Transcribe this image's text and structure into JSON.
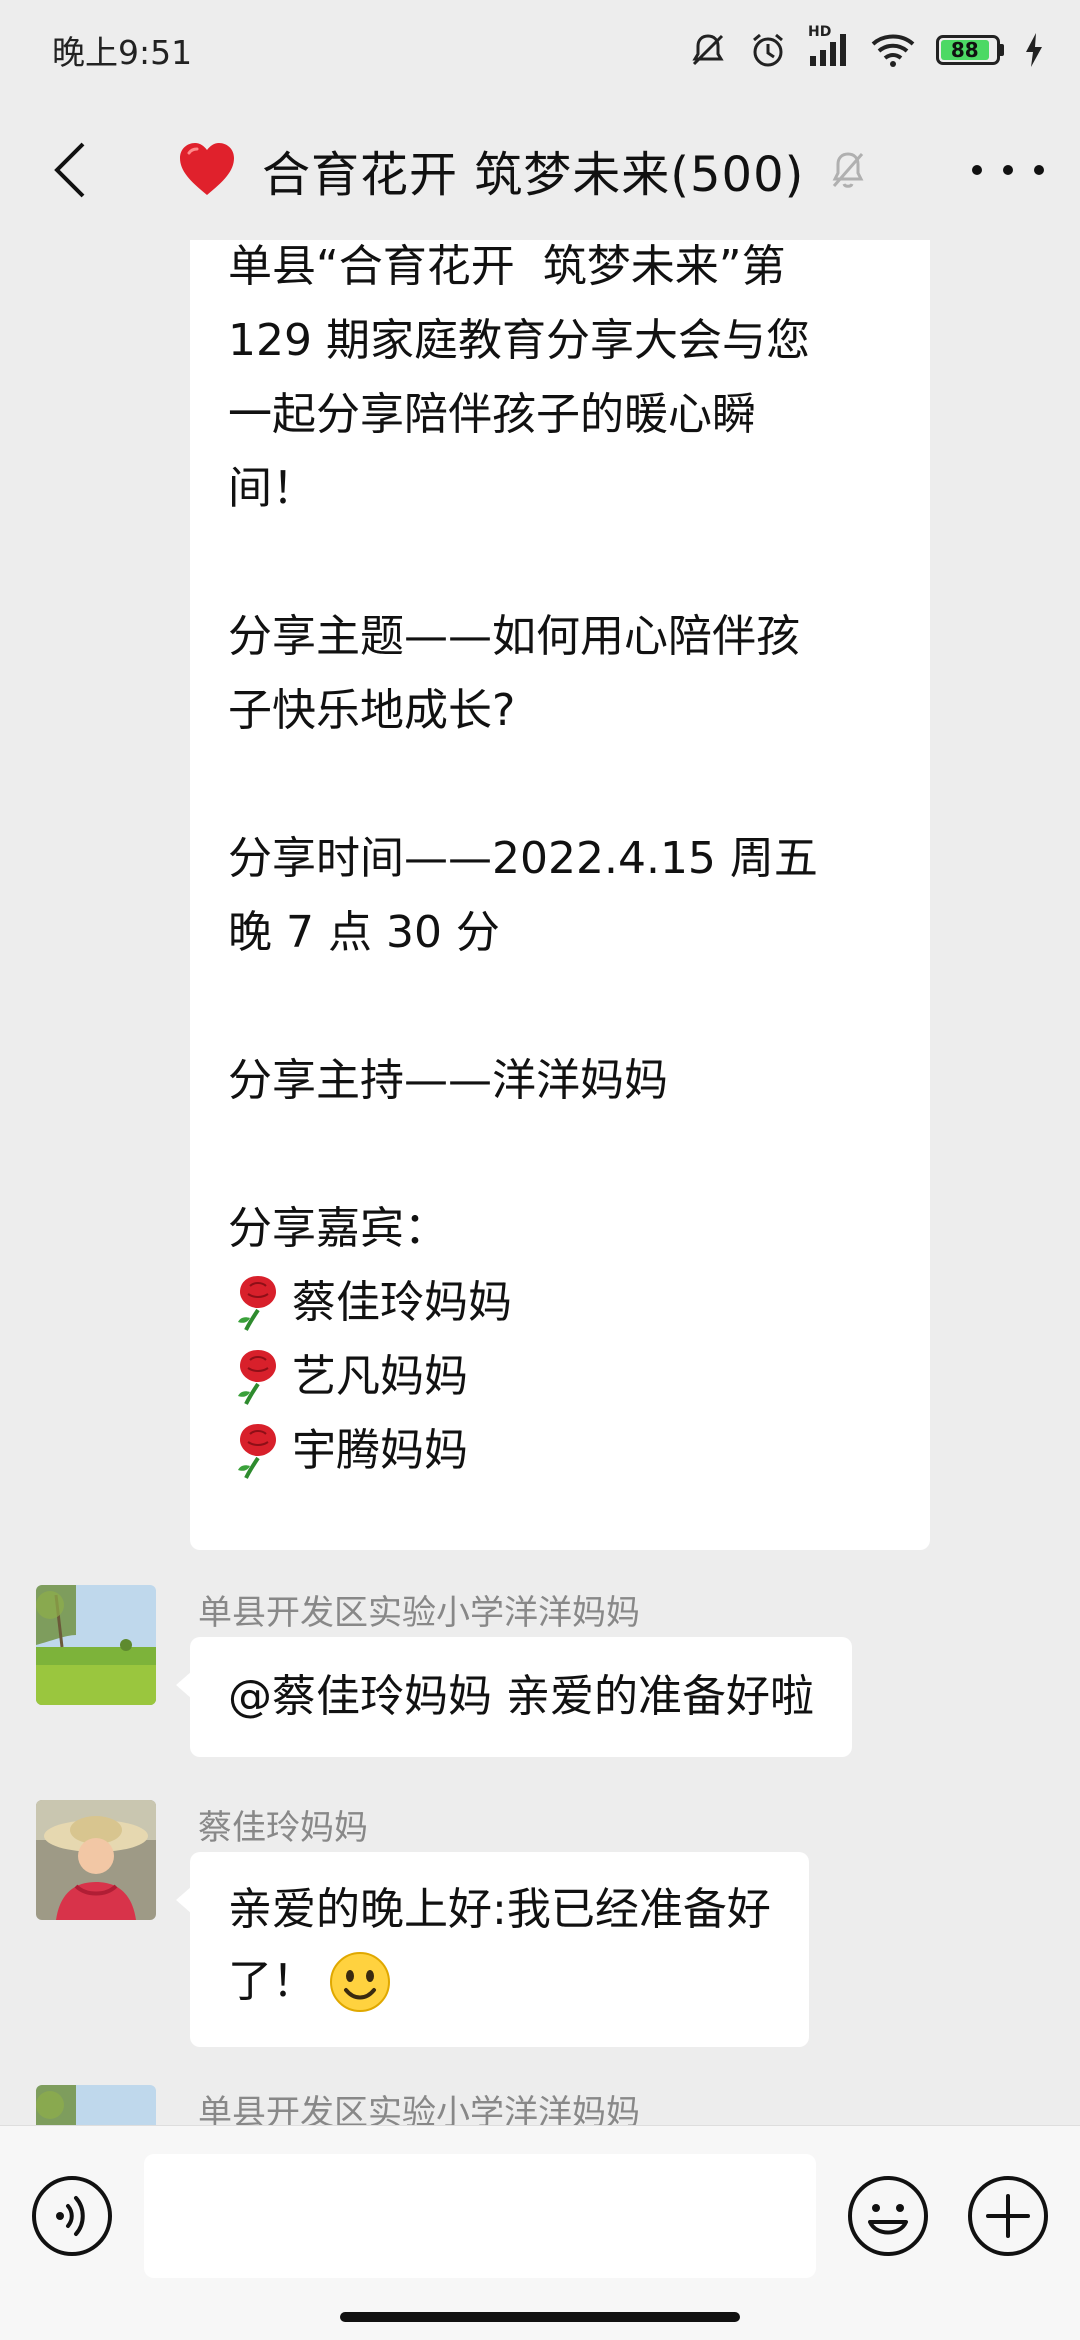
{
  "status_bar": {
    "time": "晚上9:51",
    "battery_level": "88",
    "network_label": "HD"
  },
  "header": {
    "title": "合育花开 筑梦未来(500)"
  },
  "messages": {
    "announcement": {
      "line1": "单县“合育花开  筑梦未来”第",
      "line2": "129 期家庭教育分享大会与您",
      "line3": "一起分享陪伴孩子的暖心瞬",
      "line4": "间！",
      "topic_line1": "分享主题——如何用心陪伴孩",
      "topic_line2": "子快乐地成长?",
      "time_line1": "分享时间——2022.4.15 周五",
      "time_line2": "晚 7 点 30 分",
      "host_line": "分享主持——洋洋妈妈",
      "guests_label": "分享嘉宾：",
      "guests": [
        "蔡佳玲妈妈",
        "艺凡妈妈",
        "宇腾妈妈"
      ]
    },
    "msg1": {
      "sender": "单县开发区实验小学洋洋妈妈",
      "text": "@蔡佳玲妈妈  亲爱的准备好啦"
    },
    "msg2": {
      "sender": "蔡佳玲妈妈",
      "text_line1": "亲爱的晚上好:我已经准备好",
      "text_line2": "了！"
    },
    "msg3": {
      "sender": "单县开发区实验小学洋洋妈妈"
    }
  },
  "colors": {
    "background": "#EDEDED",
    "bubble": "#FFFFFF",
    "sender_name": "#888888",
    "battery": "#4CD964"
  }
}
